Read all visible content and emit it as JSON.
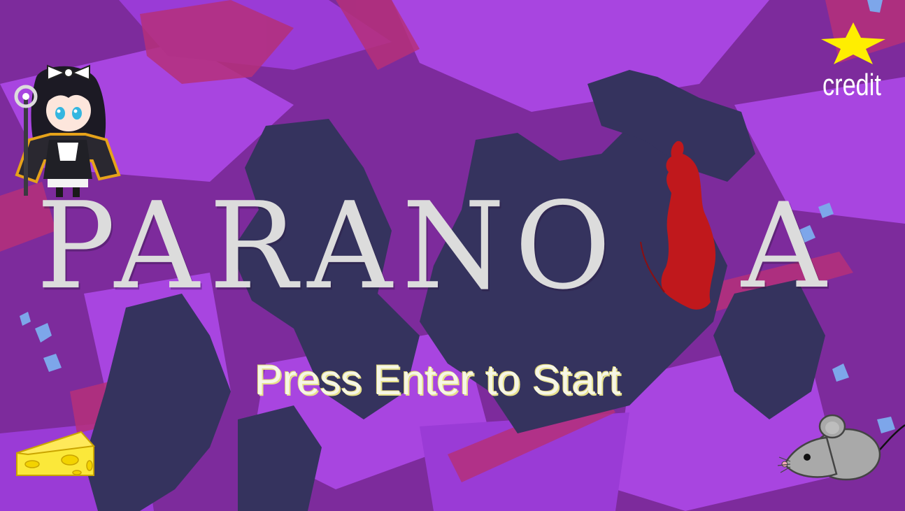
{
  "title": {
    "main": "PARANO",
    "last_letter": "A",
    "i_replacement_icon": "red-mouse-silhouette-icon"
  },
  "prompt": {
    "text": "Press Enter to Start"
  },
  "credit": {
    "label": "credit",
    "icon": "star-icon"
  },
  "characters": {
    "top_left": "chibi-character-icon",
    "bottom_left": "cheese-icon",
    "bottom_right": "mouse-icon"
  },
  "colors": {
    "background_base": "#7a2a9a",
    "violet": "#a845e0",
    "navy_shape": "#35335e",
    "magenta": "#b5307a",
    "title_text": "#dcdcdc",
    "prompt_text": "#f6f6e6",
    "star": "#ffee00",
    "mouse_red": "#c0181c",
    "cheese": "#fbe83a"
  }
}
